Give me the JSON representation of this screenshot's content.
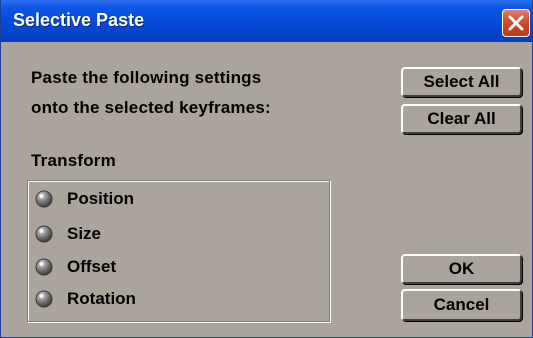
{
  "dialog": {
    "title": "Selective Paste",
    "prompt_line1": "Paste the following settings",
    "prompt_line2": "onto the selected keyframes:",
    "group_label": "Transform",
    "options": [
      {
        "label": "Position",
        "checked": false
      },
      {
        "label": "Size",
        "checked": false
      },
      {
        "label": "Offset",
        "checked": false
      },
      {
        "label": "Rotation",
        "checked": false
      }
    ],
    "buttons": {
      "select_all": "Select All",
      "clear_all": "Clear All",
      "ok": "OK",
      "cancel": "Cancel"
    },
    "icons": {
      "close": "close-icon",
      "radio": "radio-icon"
    },
    "colors": {
      "title_bar": "#0648d6",
      "dialog_bg": "#aaa49c",
      "close_button": "#d3492a"
    }
  }
}
